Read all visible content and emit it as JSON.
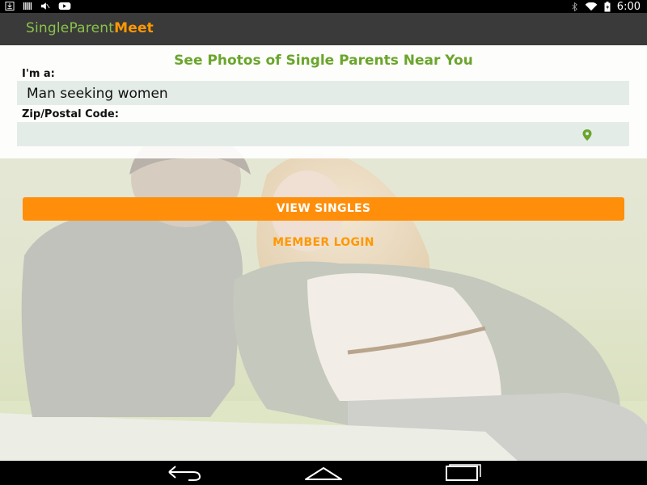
{
  "status_bar": {
    "time": "6:00",
    "left_icons": [
      "download-icon",
      "barcode-icon",
      "mute-icon",
      "youtube-icon"
    ],
    "right_icons": [
      "bluetooth-icon",
      "wifi-icon",
      "battery-icon"
    ]
  },
  "app_bar": {
    "logo_part1": "Single",
    "logo_part2": "Parent",
    "logo_part3": "Meet"
  },
  "form": {
    "headline": "See Photos of Single Parents Near You",
    "gender_label": "I'm a:",
    "gender_value": "Man seeking women",
    "zip_label": "Zip/Postal Code:",
    "zip_value": "",
    "zip_icon": "location-pin-icon"
  },
  "actions": {
    "view_singles": "VIEW SINGLES",
    "member_login": "MEMBER LOGIN"
  },
  "nav_bar": {
    "buttons": [
      "back-icon",
      "home-icon",
      "recents-icon"
    ]
  },
  "colors": {
    "brand_green": "#8bc34a",
    "brand_orange": "#ff9800",
    "headline_green": "#6aa52c",
    "button_orange": "#ff8f0a",
    "field_bg": "#e4ece8",
    "appbar_bg": "#3a3a3a"
  }
}
